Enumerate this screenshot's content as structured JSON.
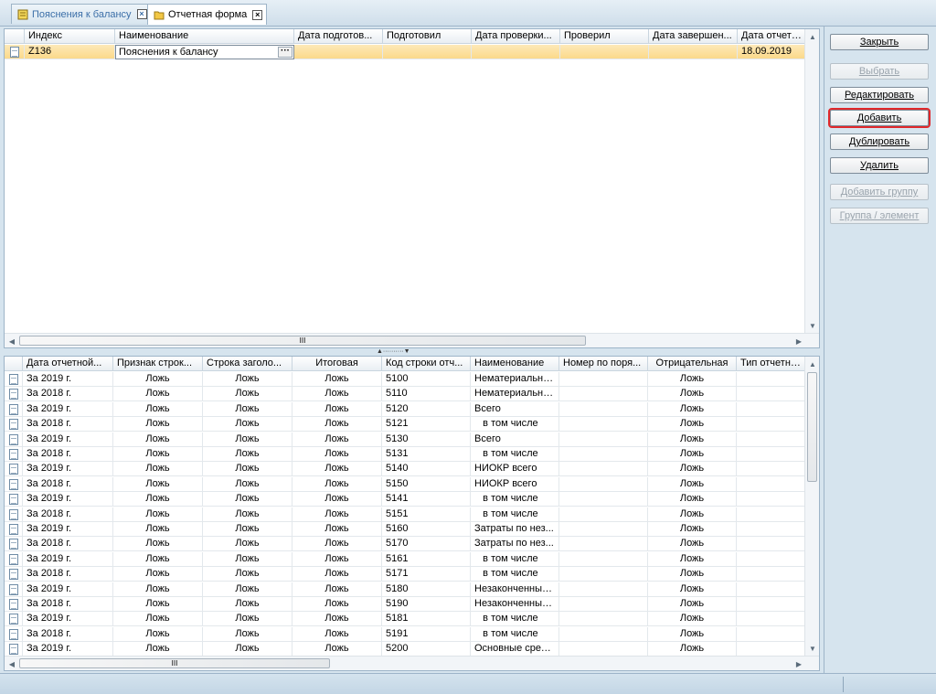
{
  "tabs": [
    {
      "label": "Пояснения к балансу",
      "active": false
    },
    {
      "label": "Отчетная форма",
      "active": true
    }
  ],
  "top_grid": {
    "columns": [
      "Индекс",
      "Наименование",
      "Дата подготов...",
      "Подготовил",
      "Дата проверки...",
      "Проверил",
      "Дата завершен...",
      "Дата отчетно"
    ],
    "rows": [
      {
        "index": "Z136",
        "name": "Пояснения к балансу",
        "prep_date": "",
        "prepared_by": "",
        "check_date": "",
        "checked_by": "",
        "complete_date": "",
        "report_date": "18.09.2019"
      }
    ],
    "scroll_grip": "III"
  },
  "bottom_grid": {
    "columns": [
      "Дата отчетной...",
      "Признак строк...",
      "Строка заголо...",
      "Итоговая",
      "Код строки отч...",
      "Наименование",
      "Номер по поря...",
      "Отрицательная",
      "Тип отчетной"
    ],
    "rows": [
      [
        "За 2019 г.",
        "Ложь",
        "Ложь",
        "Ложь",
        "5100",
        "Нематериальны...",
        "",
        "Ложь",
        ""
      ],
      [
        "За 2018 г.",
        "Ложь",
        "Ложь",
        "Ложь",
        "5110",
        "Нематериальны...",
        "",
        "Ложь",
        ""
      ],
      [
        "За 2019 г.",
        "Ложь",
        "Ложь",
        "Ложь",
        "5120",
        "Всего",
        "",
        "Ложь",
        ""
      ],
      [
        "За 2018 г.",
        "Ложь",
        "Ложь",
        "Ложь",
        "5121",
        "   в том числе",
        "",
        "Ложь",
        ""
      ],
      [
        "За 2019 г.",
        "Ложь",
        "Ложь",
        "Ложь",
        "5130",
        "Всего",
        "",
        "Ложь",
        ""
      ],
      [
        "За 2018 г.",
        "Ложь",
        "Ложь",
        "Ложь",
        "5131",
        "   в том числе",
        "",
        "Ложь",
        ""
      ],
      [
        "За 2019 г.",
        "Ложь",
        "Ложь",
        "Ложь",
        "5140",
        "НИОКР всего",
        "",
        "Ложь",
        ""
      ],
      [
        "За 2018 г.",
        "Ложь",
        "Ложь",
        "Ложь",
        "5150",
        "НИОКР всего",
        "",
        "Ложь",
        ""
      ],
      [
        "За 2019 г.",
        "Ложь",
        "Ложь",
        "Ложь",
        "5141",
        "   в том числе",
        "",
        "Ложь",
        ""
      ],
      [
        "За 2018 г.",
        "Ложь",
        "Ложь",
        "Ложь",
        "5151",
        "   в том числе",
        "",
        "Ложь",
        ""
      ],
      [
        "За 2019 г.",
        "Ложь",
        "Ложь",
        "Ложь",
        "5160",
        "Затраты по нез...",
        "",
        "Ложь",
        ""
      ],
      [
        "За 2018 г.",
        "Ложь",
        "Ложь",
        "Ложь",
        "5170",
        "Затраты по нез...",
        "",
        "Ложь",
        ""
      ],
      [
        "За 2019 г.",
        "Ложь",
        "Ложь",
        "Ложь",
        "5161",
        "   в том числе",
        "",
        "Ложь",
        ""
      ],
      [
        "За 2018 г.",
        "Ложь",
        "Ложь",
        "Ложь",
        "5171",
        "   в том числе",
        "",
        "Ложь",
        ""
      ],
      [
        "За 2019 г.",
        "Ложь",
        "Ложь",
        "Ложь",
        "5180",
        "Незаконченные...",
        "",
        "Ложь",
        ""
      ],
      [
        "За 2018 г.",
        "Ложь",
        "Ложь",
        "Ложь",
        "5190",
        "Незаконченные...",
        "",
        "Ложь",
        ""
      ],
      [
        "За 2019 г.",
        "Ложь",
        "Ложь",
        "Ложь",
        "5181",
        "   в том числе",
        "",
        "Ложь",
        ""
      ],
      [
        "За 2018 г.",
        "Ложь",
        "Ложь",
        "Ложь",
        "5191",
        "   в том числе",
        "",
        "Ложь",
        ""
      ],
      [
        "За 2019 г.",
        "Ложь",
        "Ложь",
        "Ложь",
        "5200",
        "Основные сред...",
        "",
        "Ложь",
        ""
      ]
    ],
    "scroll_grip": "III"
  },
  "buttons": [
    {
      "label": "Закрыть",
      "enabled": true,
      "highlight": false
    },
    {
      "label": "Выбрать",
      "enabled": false,
      "highlight": false
    },
    {
      "label": "Редактировать",
      "enabled": true,
      "highlight": false
    },
    {
      "label": "Добавить",
      "enabled": true,
      "highlight": true
    },
    {
      "label": "Дублировать",
      "enabled": true,
      "highlight": false
    },
    {
      "label": "Удалить",
      "enabled": true,
      "highlight": false
    },
    {
      "label": "Добавить группу",
      "enabled": false,
      "highlight": false
    },
    {
      "label": "Группа / элемент",
      "enabled": false,
      "highlight": false
    }
  ],
  "colors": {
    "highlight_outline": "#e0282b",
    "selected_row": "#fbd98a",
    "tab_inactive_text": "#3b6fa8"
  }
}
